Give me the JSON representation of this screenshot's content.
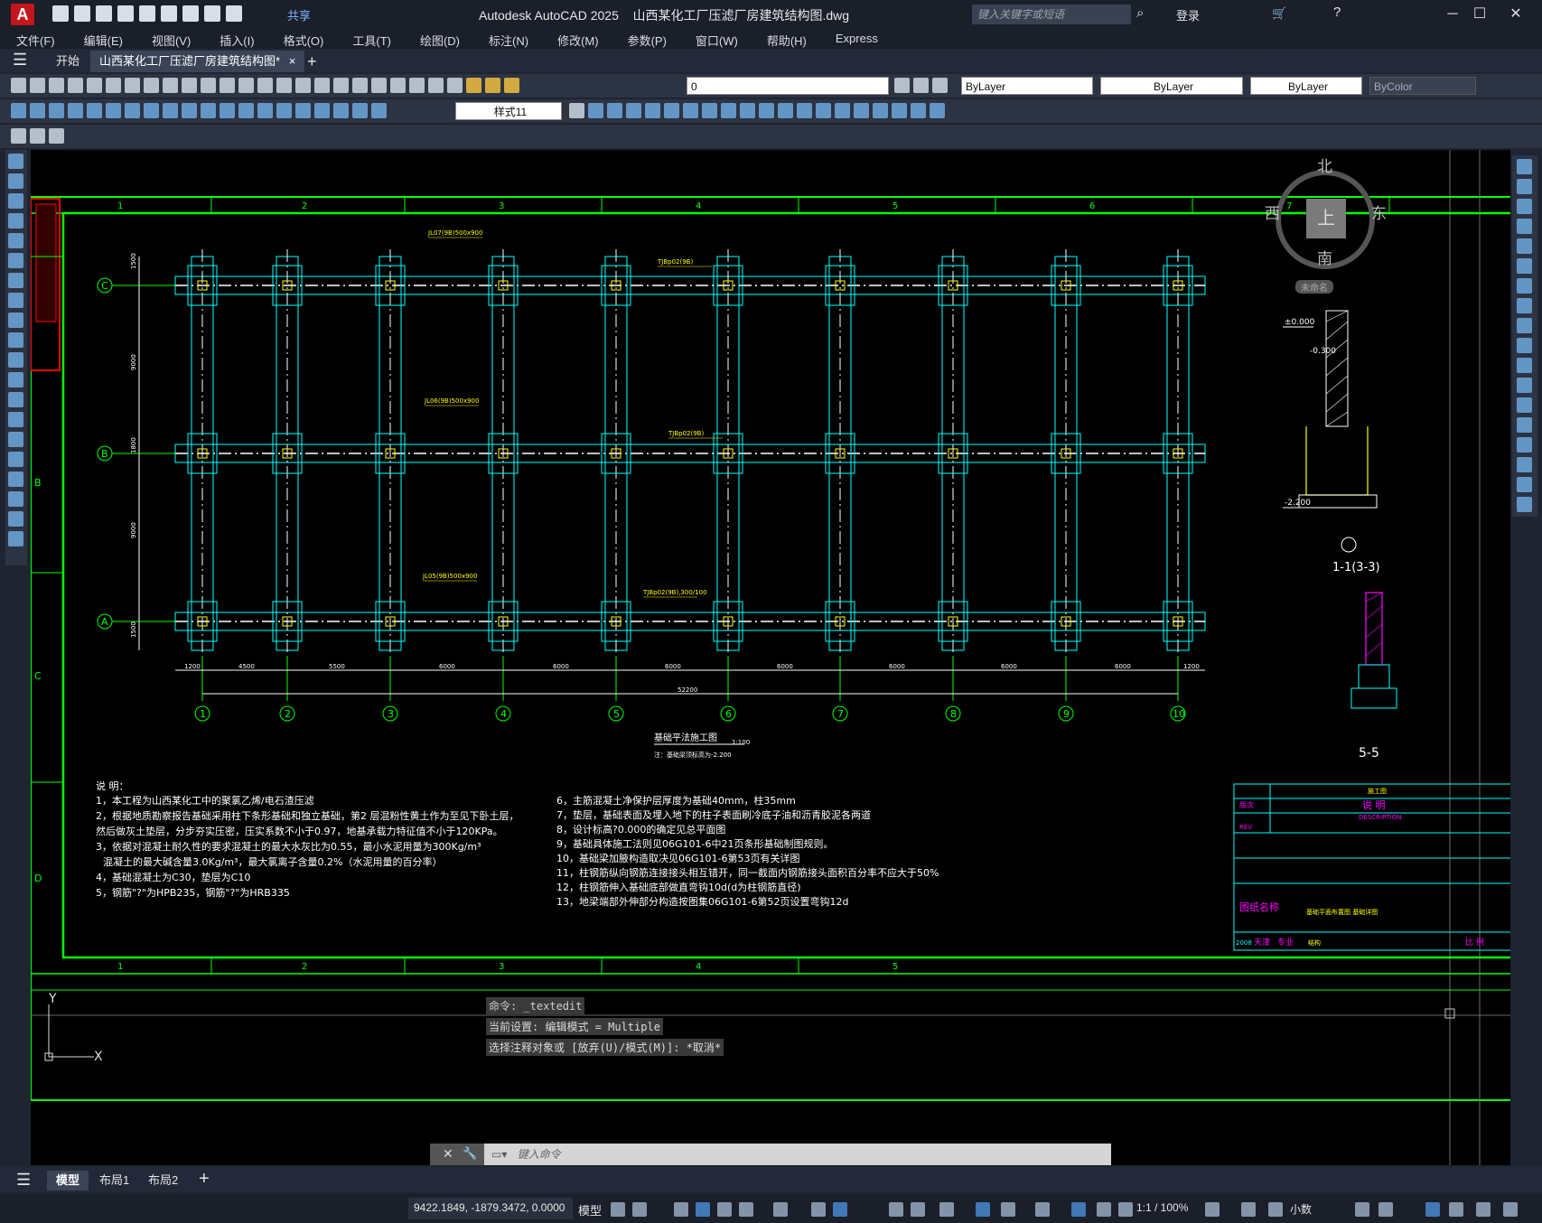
{
  "titlebar": {
    "app_name": "Autodesk AutoCAD 2025",
    "file_name": "山西某化工厂压滤厂房建筑结构图.dwg",
    "share_label": "共享",
    "search_placeholder": "键入关键字或短语",
    "login_label": "登录",
    "min": "─",
    "max": "☐",
    "close": "✕"
  },
  "menu": [
    "文件(F)",
    "编辑(E)",
    "视图(V)",
    "插入(I)",
    "格式(O)",
    "工具(T)",
    "绘图(D)",
    "标注(N)",
    "修改(M)",
    "参数(P)",
    "窗口(W)",
    "帮助(H)",
    "Express"
  ],
  "doc_tabs": {
    "start": "开始",
    "active": "山西某化工厂压滤厂房建筑结构图*",
    "close": "×",
    "add": "+"
  },
  "toolbar": {
    "layer_value": "0",
    "color": "ByLayer",
    "linetype": "ByLayer",
    "lineweight": "ByLayer",
    "plotstyle": "ByColor",
    "dimstyle": "样式11"
  },
  "viewcube": {
    "north": "北",
    "south": "南",
    "west": "西",
    "east": "东",
    "face": "上",
    "wcs": "未命名"
  },
  "drawing": {
    "top_grid_labels": [
      "1",
      "2",
      "3",
      "4",
      "5",
      "6",
      "7"
    ],
    "bottom_grid_labels": [
      "1",
      "2",
      "3",
      "4",
      "5"
    ],
    "left_zone_labels": [
      "B",
      "C",
      "D"
    ],
    "row_axes": [
      "C",
      "B",
      "A"
    ],
    "col_axes": [
      "1",
      "2",
      "3",
      "4",
      "5",
      "6",
      "7",
      "8",
      "9",
      "10"
    ],
    "bay_dims": [
      "1200",
      "4500",
      "5500",
      "6000",
      "6000",
      "6000",
      "6000",
      "6000",
      "6000",
      "6000",
      "1200"
    ],
    "total_dim": "52200",
    "row_dims": [
      "1500",
      "9000",
      "1800",
      "9000",
      "1500"
    ],
    "plan_title": "基础平法施工图",
    "plan_scale": "1:100",
    "plan_note": "注：基础梁顶标高为-2.200",
    "beam_labels": [
      "TJBp02(9B)",
      "TJBp02(9B)",
      "TJBp02(9B),300/100",
      "JL07(9B)500x900",
      "JL06(9B)500x900",
      "JL05(9B)500x900"
    ],
    "section_title": "1-1(3-3)",
    "section2_title": "5-5",
    "elevations": [
      "±0.000",
      "-0.300",
      "-2.200"
    ],
    "notes_title": "说 明：",
    "notes_left": [
      "1，本工程为山西某化工中的聚氯乙烯/电石渣压滤",
      "2，根据地质勘察报告基础采用柱下条形基础和独立基础，第2 层混粉性黄土作为至见下卧土层，",
      "然后做灰土垫层，分步夯实压密，压实系数不小于0.97，地基承载力特征值不小于120KPa。",
      "3，依据对混凝土耐久性的要求混凝土的最大水灰比为0.55，最小水泥用量为300Kg/m³",
      "混凝土的最大碱含量3.0Kg/m³，最大氯离子含量0.2%（水泥用量的百分率）",
      "4，基础混凝土为C30，垫层为C10",
      "5，钢筋\"?\"为HPB235，钢筋\"?\"为HRB335"
    ],
    "notes_right": [
      "6，主筋混凝土净保护层厚度为基础40mm，柱35mm",
      "7，垫层，基础表面及埋入地下的柱子表面刷冷底子油和沥青胶泥各两道",
      "8，设计标高?0.000的确定见总平面图",
      "9，基础具体施工法则见06G101-6中21页条形基础制图规则。",
      "10，基础梁加腋构造取决见06G101-6第53页有关详图",
      "11，柱钢筋纵向钢筋连接接头相互错开，同一截面内钢筋接头面积百分率不应大于50%",
      "12，柱钢筋伸入基础底部做直弯钩10d(d为柱钢筋直径)",
      "13，地梁端部外伸部分构造按图集06G101-6第52页设置弯钩12d"
    ],
    "titleblock": {
      "rev": "版次",
      "rev_en": "REV",
      "desc": "说    明",
      "desc_en": "DESCRIPTION",
      "issue": "施工图",
      "drawing_name_label": "图纸名称",
      "drawing_name_value": "基础平面布置图  基础详图",
      "year": "2008",
      "zone": "天津",
      "major": "专业",
      "major_value": "结构",
      "scale": "比 例"
    },
    "ucs": {
      "y": "Y",
      "x": "X"
    }
  },
  "command": {
    "history": [
      "命令: _textedit",
      "当前设置: 编辑模式 = Multiple",
      "选择注释对象或 [放弃(U)/模式(M)]: *取消*"
    ],
    "placeholder": "键入命令"
  },
  "layout_tabs": [
    "模型",
    "布局1",
    "布局2"
  ],
  "status": {
    "coords": "9422.1849, -1879.3472, 0.0000",
    "model": "模型",
    "scale": "1:1 / 100%",
    "units": "小数"
  },
  "colors": {
    "grid_green": "#00ff00",
    "beam_cyan": "#00ffff",
    "text_yellow": "#ffff00",
    "text_white": "#ffffff",
    "magenta": "#ff00ff"
  }
}
